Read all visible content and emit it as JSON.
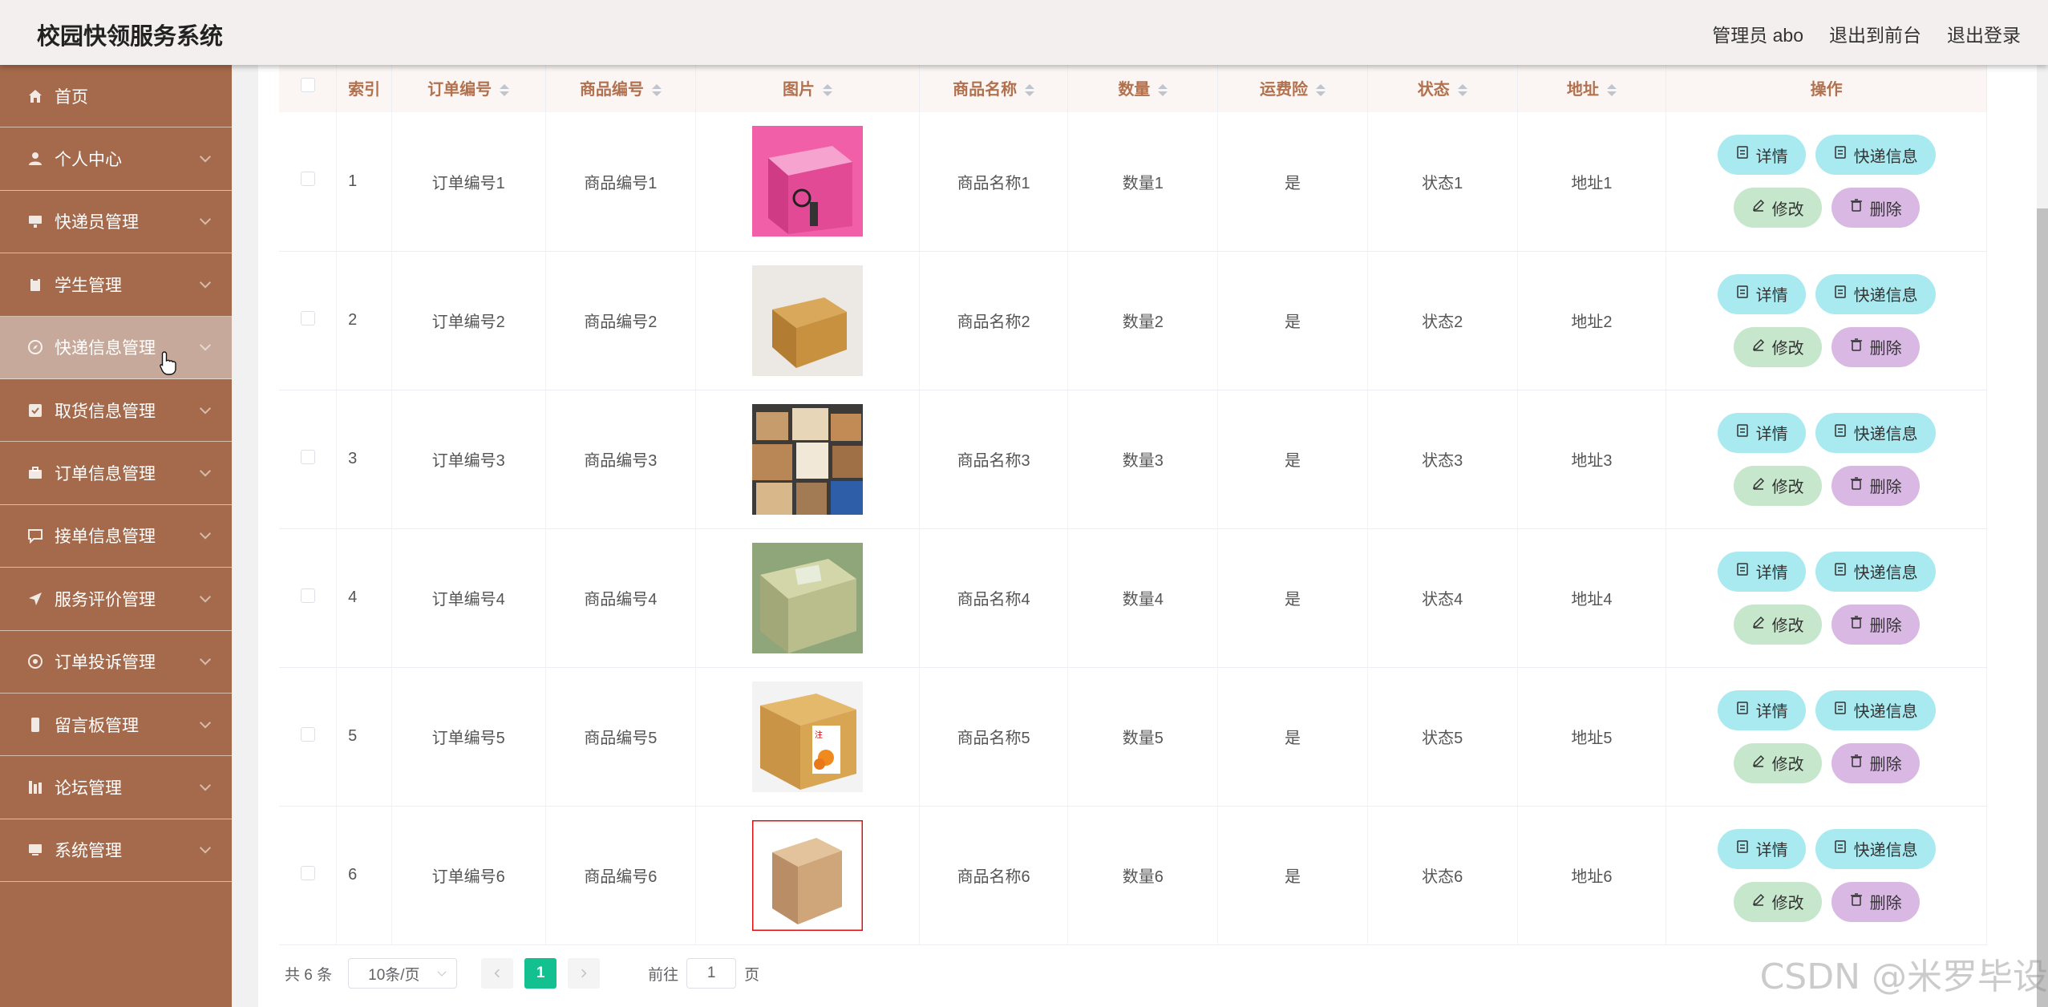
{
  "app_title": "校园快领服务系统",
  "header": {
    "user": "管理员 abo",
    "to_front": "退出到前台",
    "logout": "退出登录"
  },
  "sidebar": {
    "items": [
      {
        "label": "首页",
        "icon": "home-icon"
      },
      {
        "label": "个人中心",
        "icon": "user-icon"
      },
      {
        "label": "快递员管理",
        "icon": "monitor-icon"
      },
      {
        "label": "学生管理",
        "icon": "clipboard-icon"
      },
      {
        "label": "快递信息管理",
        "icon": "compass-icon",
        "active": true
      },
      {
        "label": "取货信息管理",
        "icon": "check-icon"
      },
      {
        "label": "订单信息管理",
        "icon": "briefcase-icon"
      },
      {
        "label": "接单信息管理",
        "icon": "chat-icon"
      },
      {
        "label": "服务评价管理",
        "icon": "send-icon"
      },
      {
        "label": "订单投诉管理",
        "icon": "circle-icon"
      },
      {
        "label": "留言板管理",
        "icon": "phone-icon"
      },
      {
        "label": "论坛管理",
        "icon": "grid-icon"
      },
      {
        "label": "系统管理",
        "icon": "screen-icon"
      }
    ]
  },
  "table": {
    "headers": {
      "index": "索引",
      "order_no": "订单编号",
      "product_no": "商品编号",
      "image": "图片",
      "product_name": "商品名称",
      "quantity": "数量",
      "insurance": "运费险",
      "status": "状态",
      "address": "地址",
      "actions": "操作"
    },
    "rows": [
      {
        "index": "1",
        "order_no": "订单编号1",
        "product_no": "商品编号1",
        "product_name": "商品名称1",
        "quantity": "数量1",
        "insurance": "是",
        "status": "状态1",
        "address": "地址1"
      },
      {
        "index": "2",
        "order_no": "订单编号2",
        "product_no": "商品编号2",
        "product_name": "商品名称2",
        "quantity": "数量2",
        "insurance": "是",
        "status": "状态2",
        "address": "地址2"
      },
      {
        "index": "3",
        "order_no": "订单编号3",
        "product_no": "商品编号3",
        "product_name": "商品名称3",
        "quantity": "数量3",
        "insurance": "是",
        "status": "状态3",
        "address": "地址3"
      },
      {
        "index": "4",
        "order_no": "订单编号4",
        "product_no": "商品编号4",
        "product_name": "商品名称4",
        "quantity": "数量4",
        "insurance": "是",
        "status": "状态4",
        "address": "地址4"
      },
      {
        "index": "5",
        "order_no": "订单编号5",
        "product_no": "商品编号5",
        "product_name": "商品名称5",
        "quantity": "数量5",
        "insurance": "是",
        "status": "状态5",
        "address": "地址5"
      },
      {
        "index": "6",
        "order_no": "订单编号6",
        "product_no": "商品编号6",
        "product_name": "商品名称6",
        "quantity": "数量6",
        "insurance": "是",
        "status": "状态6",
        "address": "地址6"
      }
    ],
    "buttons": {
      "detail": "详情",
      "express": "快递信息",
      "edit": "修改",
      "delete": "删除"
    }
  },
  "pagination": {
    "total": "共 6 条",
    "page_size": "10条/页",
    "current_page": "1",
    "goto_prefix": "前往",
    "goto_value": "1",
    "goto_suffix": "页"
  },
  "watermark": "CSDN @米罗毕设",
  "colors": {
    "sidebar_bg": "#a46a4b",
    "sidebar_active": "#c6a99a",
    "header_text": "#b2714e",
    "btn_detail": "#a9eaf0",
    "btn_edit": "#c7e7cd",
    "btn_delete": "#d9b8e4",
    "page_active": "#13c08f"
  }
}
